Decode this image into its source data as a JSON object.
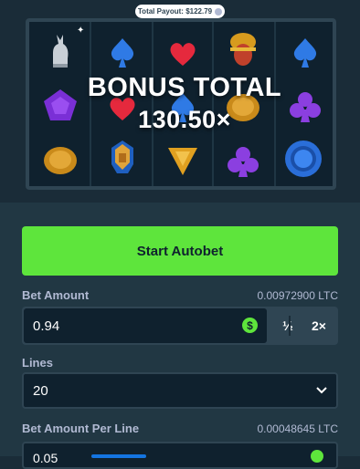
{
  "payout": {
    "label": "Total Payout: $122.79"
  },
  "bonus": {
    "title": "BONUS TOTAL",
    "multiplier": "130.50×"
  },
  "reels": {
    "symbols": [
      "anubis-icon",
      "spade-icon",
      "heart-icon",
      "scarab-icon",
      "spade-icon",
      "pentagon-gem-icon",
      "heart-icon",
      "spade-icon",
      "gold-coin-icon",
      "club-icon",
      "gold-coin-icon",
      "pharaoh-icon",
      "triangle-gem-icon",
      "club-icon",
      "blue-ring-icon"
    ]
  },
  "autobet": {
    "button_label": "Start Autobet"
  },
  "bet_amount": {
    "label": "Bet Amount",
    "crypto_value": "0.00972900 LTC",
    "value": "0.94",
    "half_label": "½",
    "double_label": "2×"
  },
  "lines": {
    "label": "Lines",
    "value": "20"
  },
  "bet_per_line": {
    "label": "Bet Amount Per Line",
    "crypto_value": "0.00048645 LTC",
    "value": "0.05"
  },
  "colors": {
    "accent_green": "#5ee53c",
    "panel": "#213743",
    "background": "#1a2c38",
    "input": "#0f212e"
  }
}
